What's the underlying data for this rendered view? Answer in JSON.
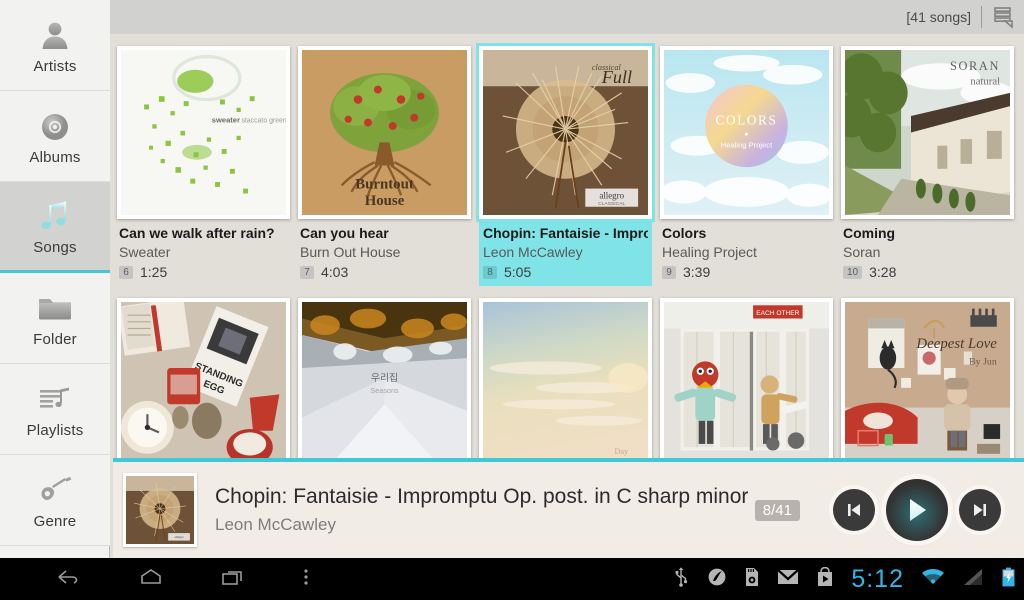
{
  "sidebar": {
    "items": [
      {
        "label": "Artists",
        "icon": "person-icon",
        "active": false
      },
      {
        "label": "Albums",
        "icon": "disc-icon",
        "active": false
      },
      {
        "label": "Songs",
        "icon": "music-note-icon",
        "active": true
      },
      {
        "label": "Folder",
        "icon": "folder-icon",
        "active": false
      },
      {
        "label": "Playlists",
        "icon": "playlist-icon",
        "active": false
      },
      {
        "label": "Genre",
        "icon": "guitar-icon",
        "active": false
      }
    ]
  },
  "header": {
    "song_count": "[41 songs]",
    "view_toggle_icon": "list-view-icon"
  },
  "grid": {
    "rows": [
      [
        {
          "title": "Can we walk after rain?",
          "artist": "Sweater",
          "track": "6",
          "duration": "1:25",
          "selected": false,
          "art": "sweater-staccato-green"
        },
        {
          "title": "Can you hear",
          "artist": "Burn Out House",
          "track": "7",
          "duration": "4:03",
          "selected": false,
          "art": "burnout-house-tree"
        },
        {
          "title": "Chopin: Fantaisie - Impromptu",
          "artist": "Leon McCawley",
          "track": "8",
          "duration": "5:05",
          "selected": true,
          "art": "allegro-dandelion"
        },
        {
          "title": "Colors",
          "artist": "Healing Project",
          "track": "9",
          "duration": "3:39",
          "selected": false,
          "art": "colors-sky-orb"
        },
        {
          "title": "Coming",
          "artist": "Soran",
          "track": "10",
          "duration": "3:28",
          "selected": false,
          "art": "soran-natural-house"
        }
      ],
      [
        {
          "art": "standing-egg-desk"
        },
        {
          "art": "inverted-landscape"
        },
        {
          "art": "pastel-sky"
        },
        {
          "art": "each-other-storefront"
        },
        {
          "art": "deepest-love-by-jun"
        }
      ]
    ]
  },
  "player": {
    "title": "Chopin: Fantaisie - Impromptu Op. post. in C sharp minor",
    "artist": "Leon McCawley",
    "counter": "8/41",
    "prev_icon": "skip-previous-icon",
    "play_icon": "play-icon",
    "next_icon": "skip-next-icon",
    "art": "allegro-dandelion"
  },
  "navbar": {
    "back_icon": "back-icon",
    "home_icon": "home-icon",
    "recents_icon": "recents-icon",
    "menu_icon": "overflow-menu-icon",
    "status_icons": [
      "usb-icon",
      "sync-icon",
      "sd-card-icon",
      "gmail-icon",
      "play-store-icon"
    ],
    "clock": "5:12",
    "wifi_icon": "wifi-icon",
    "signal_icon": "signal-icon",
    "battery_icon": "battery-charging-icon"
  },
  "colors": {
    "accent": "#3fc9d6",
    "selection": "#7fe3e8",
    "app_bg": "#e2ded8",
    "player_bg": "#f2ece6",
    "clock": "#33b5e5"
  }
}
